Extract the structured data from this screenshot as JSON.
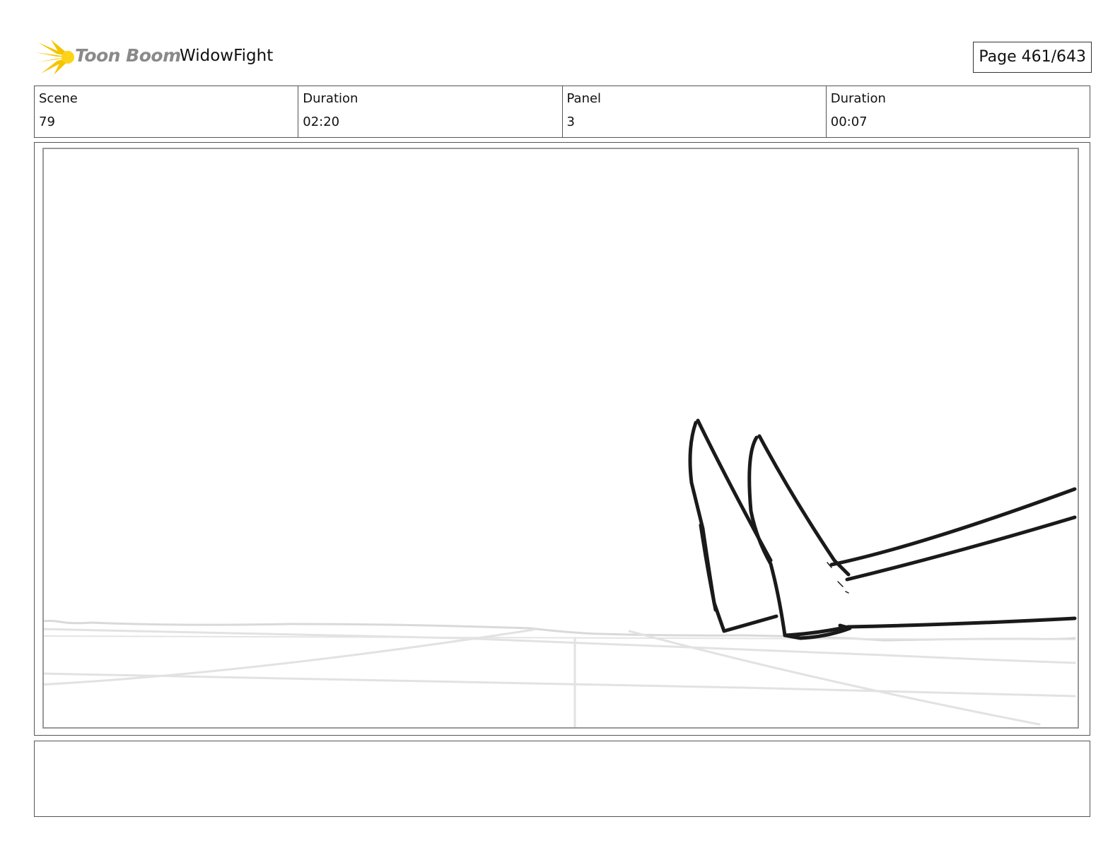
{
  "header": {
    "logo_text": "Toon Boom",
    "project_title": "WidowFight",
    "page_indicator": "Page 461/643"
  },
  "info": [
    {
      "label": "Scene",
      "value": "79"
    },
    {
      "label": "Duration",
      "value": "02:20"
    },
    {
      "label": "Panel",
      "value": "3"
    },
    {
      "label": "Duration",
      "value": "00:07"
    }
  ],
  "panel": {
    "description": "",
    "sketch_stroke_color": "#1a1a1a",
    "guide_line_color": "#d6d6d6"
  },
  "notes": {
    "text": ""
  },
  "colors": {
    "logo_flame": "#f5c400",
    "logo_text": "#8a8a8a",
    "border": "#555555"
  }
}
